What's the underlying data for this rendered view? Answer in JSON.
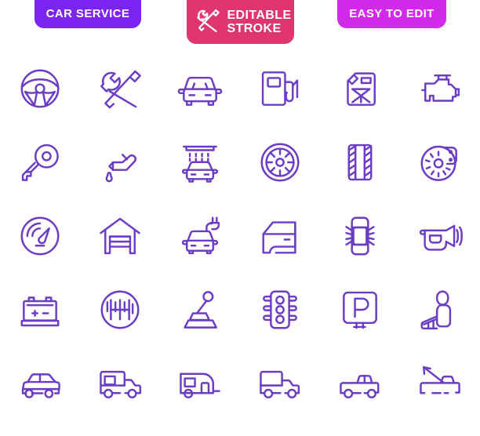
{
  "header": {
    "badges": [
      {
        "id": "car-service",
        "label": "CAR SERVICE",
        "color": "#7B26F0",
        "icon": null
      },
      {
        "id": "editable-stroke",
        "label": "EDITABLE\nSTROKE",
        "label_line1": "EDITABLE",
        "label_line2": "STROKE",
        "color": "#E0366F",
        "icon": "wrench-screwdriver-icon"
      },
      {
        "id": "easy-to-edit",
        "label": "EASY TO EDIT",
        "color": "#CF2BE8",
        "icon": null
      }
    ]
  },
  "grid": {
    "columns": 6,
    "rows": 5,
    "stroke_color": "#6B3CC4",
    "background_color": "#FFFFFF",
    "icons": [
      {
        "name": "steering-wheel-icon",
        "label": "Steering wheel"
      },
      {
        "name": "wrench-screwdriver-icon",
        "label": "Wrench and screwdriver"
      },
      {
        "name": "car-front-icon",
        "label": "Car front view"
      },
      {
        "name": "fuel-pump-icon",
        "label": "Fuel pump"
      },
      {
        "name": "jerry-can-icon",
        "label": "Jerry can"
      },
      {
        "name": "engine-icon",
        "label": "Engine"
      },
      {
        "name": "car-key-icon",
        "label": "Car key"
      },
      {
        "name": "oil-can-icon",
        "label": "Oil can with drop"
      },
      {
        "name": "car-wash-icon",
        "label": "Car wash"
      },
      {
        "name": "wheel-rim-icon",
        "label": "Wheel rim"
      },
      {
        "name": "tire-icon",
        "label": "Tire tread"
      },
      {
        "name": "brake-disc-icon",
        "label": "Brake disc and caliper"
      },
      {
        "name": "speedometer-icon",
        "label": "Speedometer"
      },
      {
        "name": "garage-icon",
        "label": "Garage"
      },
      {
        "name": "electric-car-icon",
        "label": "Electric car charging"
      },
      {
        "name": "car-door-icon",
        "label": "Car door"
      },
      {
        "name": "car-sensors-icon",
        "label": "Car top view with sensors"
      },
      {
        "name": "car-horn-icon",
        "label": "Car horn"
      },
      {
        "name": "car-battery-icon",
        "label": "Car battery"
      },
      {
        "name": "gear-pattern-icon",
        "label": "Gear shift pattern"
      },
      {
        "name": "gear-stick-icon",
        "label": "Gear stick"
      },
      {
        "name": "traffic-light-icon",
        "label": "Traffic light"
      },
      {
        "name": "parking-sign-icon",
        "label": "Parking sign"
      },
      {
        "name": "car-seat-icon",
        "label": "Car seat"
      },
      {
        "name": "sedan-icon",
        "label": "Sedan side view"
      },
      {
        "name": "camper-van-icon",
        "label": "Camper van"
      },
      {
        "name": "caravan-trailer-icon",
        "label": "Caravan trailer"
      },
      {
        "name": "delivery-truck-icon",
        "label": "Delivery truck"
      },
      {
        "name": "pickup-truck-icon",
        "label": "Pickup truck"
      },
      {
        "name": "tow-truck-icon",
        "label": "Tow truck"
      }
    ]
  }
}
